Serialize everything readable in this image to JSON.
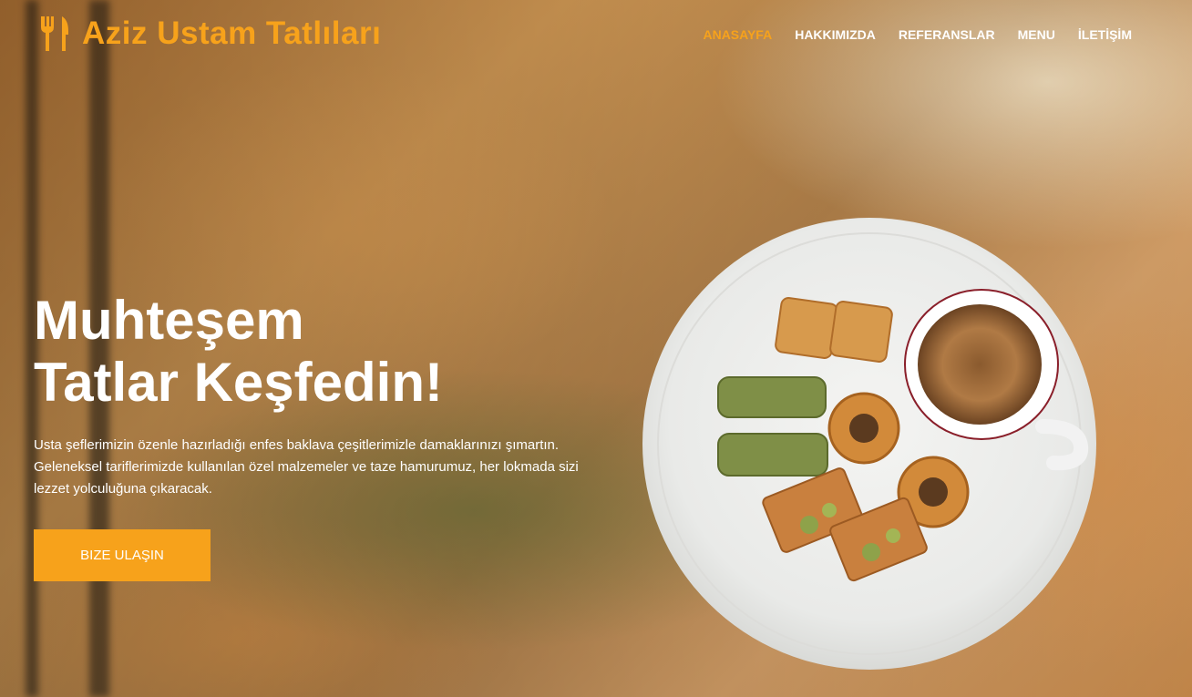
{
  "brand": {
    "name": "Aziz Ustam Tatlıları",
    "icon": "utensils-icon",
    "color": "#f7a21b"
  },
  "nav": {
    "items": [
      {
        "label": "ANASAYFA",
        "active": true
      },
      {
        "label": "HAKKIMIZDA",
        "active": false
      },
      {
        "label": "REFERANSLAR",
        "active": false
      },
      {
        "label": "MENU",
        "active": false
      },
      {
        "label": "İLETİŞİM",
        "active": false
      }
    ]
  },
  "hero": {
    "title_line1": "Muhteşem",
    "title_line2": "Tatlar Keşfedin!",
    "description": "Usta şeflerimizin özenle hazırladığı enfes baklava çeşitlerimizle damaklarınızı şımartın. Geleneksel tariflerimizde kullanılan özel malzemeler ve taze hamurumuz, her lokmada sizi lezzet yolculuğuna çıkaracak.",
    "cta_label": "BIZE ULAŞIN",
    "accent_color": "#f7a21b"
  }
}
